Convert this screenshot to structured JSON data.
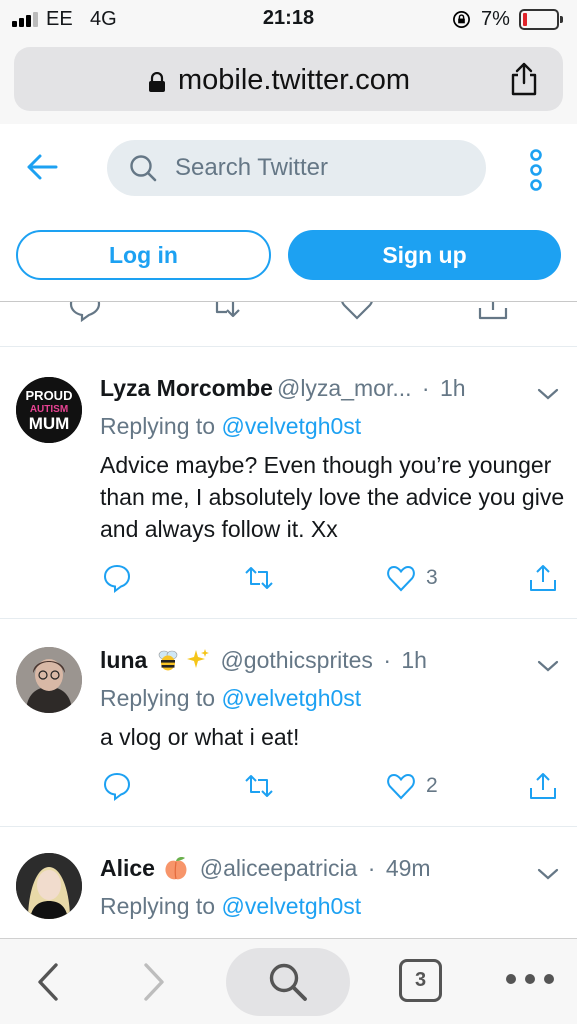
{
  "status_bar": {
    "carrier": "EE",
    "network": "4G",
    "time": "21:18",
    "battery_percent": "7%",
    "battery_level": 0.07,
    "battery_color": "#e0242b"
  },
  "browser": {
    "url": "mobile.twitter.com",
    "lock_icon": "lock-icon",
    "share_icon": "share-icon"
  },
  "header": {
    "search_placeholder": "Search Twitter",
    "login_label": "Log in",
    "signup_label": "Sign up",
    "accent_color": "#1da1f2"
  },
  "tweets": [
    {
      "name": "Lyza Morcombe",
      "handle": "@lyza_mor...",
      "separator": "·",
      "time": "1h",
      "replying_prefix": "Replying to",
      "replying_to": "@velvetgh0st",
      "text": "Advice maybe? Even though you’re younger than me, I absolutely love the advice you give and always follow it. Xx",
      "likes": "3",
      "avatar_text": [
        "PROUD",
        "AUTISM",
        "MUM"
      ]
    },
    {
      "name": "luna",
      "handle": "@gothicsprites",
      "separator": "·",
      "time": "1h",
      "replying_prefix": "Replying to",
      "replying_to": "@velvetgh0st",
      "text": "a vlog or what i eat!",
      "likes": "2",
      "emojis": [
        "bee-emoji",
        "sparkles-emoji"
      ]
    },
    {
      "name": "Alice",
      "handle": "@aliceepatricia",
      "separator": "·",
      "time": "49m",
      "replying_prefix": "Replying to",
      "replying_to": "@velvetgh0st",
      "emojis": [
        "peach-emoji"
      ]
    }
  ],
  "toolbar": {
    "tab_count": "3"
  }
}
